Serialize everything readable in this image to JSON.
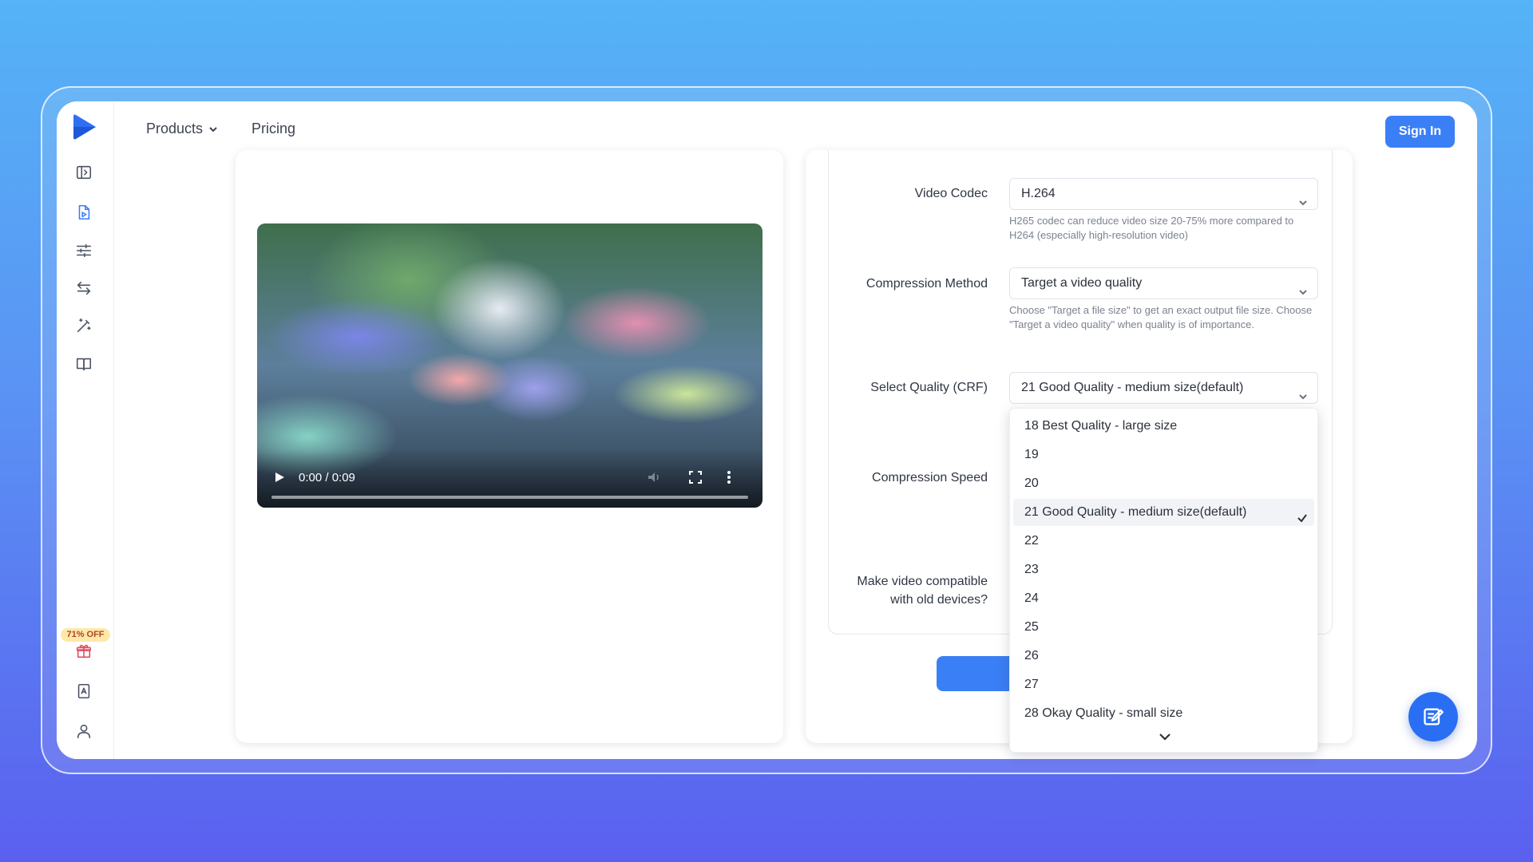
{
  "header": {
    "products_label": "Products",
    "pricing_label": "Pricing",
    "sign_in_label": "Sign In"
  },
  "sidebar": {
    "promo_badge": "71% OFF",
    "icons": [
      "panel-toggle-icon",
      "file-video-icon",
      "sliders-icon",
      "convert-arrows-icon",
      "magic-wand-icon",
      "book-icon",
      "gift-icon",
      "document-a-icon",
      "user-icon"
    ]
  },
  "video": {
    "time": "0:00 / 0:09"
  },
  "form": {
    "video_codec": {
      "label": "Video Codec",
      "value": "H.264",
      "hint": "H265 codec can reduce video size 20-75% more compared to H264 (especially high-resolution video)"
    },
    "compression_method": {
      "label": "Compression Method",
      "value": "Target a video quality",
      "hint": "Choose \"Target a file size\" to get an exact output file size. Choose \"Target a video quality\" when quality is of importance."
    },
    "quality": {
      "label": "Select Quality (CRF)",
      "value": "21 Good Quality - medium size(default)"
    },
    "compression_speed": {
      "label": "Compression Speed"
    },
    "compat": {
      "label_line1": "Make video compatible",
      "label_line2": "with old devices?"
    }
  },
  "dropdown": {
    "options": [
      "18 Best Quality - large size",
      "19",
      "20",
      "21 Good Quality - medium size(default)",
      "22",
      "23",
      "24",
      "25",
      "26",
      "27",
      "28 Okay Quality - small size"
    ],
    "selected_index": 3
  },
  "colors": {
    "accent": "#3b7ff6",
    "brand_logo": "#2f6ff4",
    "promo_bg": "#fde9a8",
    "promo_text": "#b2432a",
    "gift": "#e24a5d"
  }
}
